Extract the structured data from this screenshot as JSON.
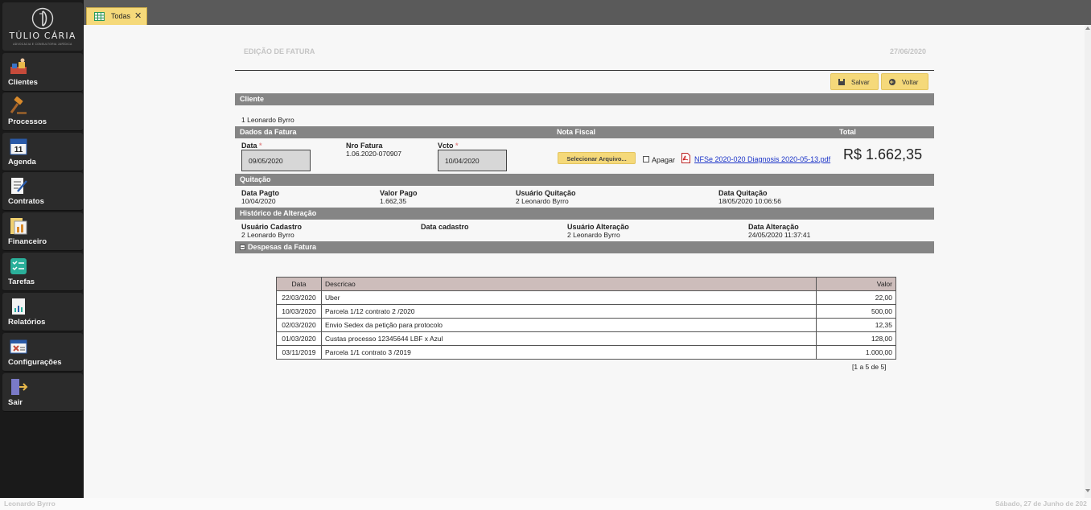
{
  "sidebar": {
    "logo": {
      "name": "TÚLIO CÁRIA",
      "tagline": "ADVOCACIA E CONSULTORIA JURÍDICA"
    },
    "items": [
      {
        "label": "Clientes",
        "icon": "clients-icon"
      },
      {
        "label": "Processos",
        "icon": "gavel-icon"
      },
      {
        "label": "Agenda",
        "icon": "calendar-icon",
        "icon_text": "11"
      },
      {
        "label": "Contratos",
        "icon": "contract-icon"
      },
      {
        "label": "Financeiro",
        "icon": "finance-icon"
      },
      {
        "label": "Tarefas",
        "icon": "tasks-icon"
      },
      {
        "label": "Relatórios",
        "icon": "report-icon"
      },
      {
        "label": "Configurações",
        "icon": "settings-icon"
      },
      {
        "label": "Sair",
        "icon": "exit-icon"
      }
    ]
  },
  "tabs": [
    {
      "label": "Todas",
      "close": "✕",
      "icon": "table-icon"
    }
  ],
  "page": {
    "title": "EDIÇÃO DE FATURA",
    "date": "27/06/2020"
  },
  "buttons": {
    "save": "Salvar",
    "back": "Voltar"
  },
  "sections": {
    "cliente": "Cliente",
    "dados": "Dados da Fatura",
    "nota": "Nota Fiscal",
    "total": "Total",
    "quitacao": "Quitação",
    "historico": "Histórico de Alteração",
    "despesas": "Despesas da Fatura"
  },
  "client": {
    "value": "1 Leonardo Byrro"
  },
  "invoice": {
    "data_label": "Data",
    "data_value": "09/05/2020",
    "nro_label": "Nro Fatura",
    "nro_value": "1.06.2020-070907",
    "vcto_label": "Vcto",
    "vcto_value": "10/04/2020",
    "required_mark": "*",
    "select_file": "Selecionar Arquivo...",
    "apagar": "Apagar",
    "pdf_link": "NFSe 2020-020 Diagnosis 2020-05-13.pdf",
    "total": "R$ 1.662,35"
  },
  "quitacao": {
    "data_pagto_label": "Data Pagto",
    "data_pagto": "10/04/2020",
    "valor_pago_label": "Valor Pago",
    "valor_pago": "1.662,35",
    "usuario_label": "Usuário Quitação",
    "usuario": "2 Leonardo Byrro",
    "data_quitacao_label": "Data Quitação",
    "data_quitacao": "18/05/2020 10:06:56"
  },
  "historico": {
    "usuario_cad_label": "Usuário Cadastro",
    "usuario_cad": "2 Leonardo Byrro",
    "data_cad_label": "Data cadastro",
    "usuario_alt_label": "Usuário Alteração",
    "usuario_alt": "2 Leonardo Byrro",
    "data_alt_label": "Data Alteração",
    "data_alt": "24/05/2020 11:37:41"
  },
  "expenses": {
    "headers": [
      "Data",
      "Descricao",
      "Valor"
    ],
    "rows": [
      {
        "date": "22/03/2020",
        "desc": "Uber",
        "value": "22,00"
      },
      {
        "date": "10/03/2020",
        "desc": "Parcela 1/12 contrato 2 /2020",
        "value": "500,00"
      },
      {
        "date": "02/03/2020",
        "desc": "Envio Sedex da petição para protocolo",
        "value": "12,35"
      },
      {
        "date": "01/03/2020",
        "desc": "Custas processo 12345644 LBF x Azul",
        "value": "128,00"
      },
      {
        "date": "03/11/2019",
        "desc": "Parcela 1/1 contrato 3 /2019",
        "value": "1.000,00"
      }
    ],
    "pager": "[1 a 5 de 5]"
  },
  "footer": {
    "user": "Leonardo Byrro",
    "date": "Sábado, 27 de Junho de 202"
  },
  "colors": {
    "accent": "#f5d97a",
    "section": "#858585",
    "sidebar": "#1a1a1a",
    "table_header": "#cdbdbb",
    "link": "#1a33c8"
  }
}
